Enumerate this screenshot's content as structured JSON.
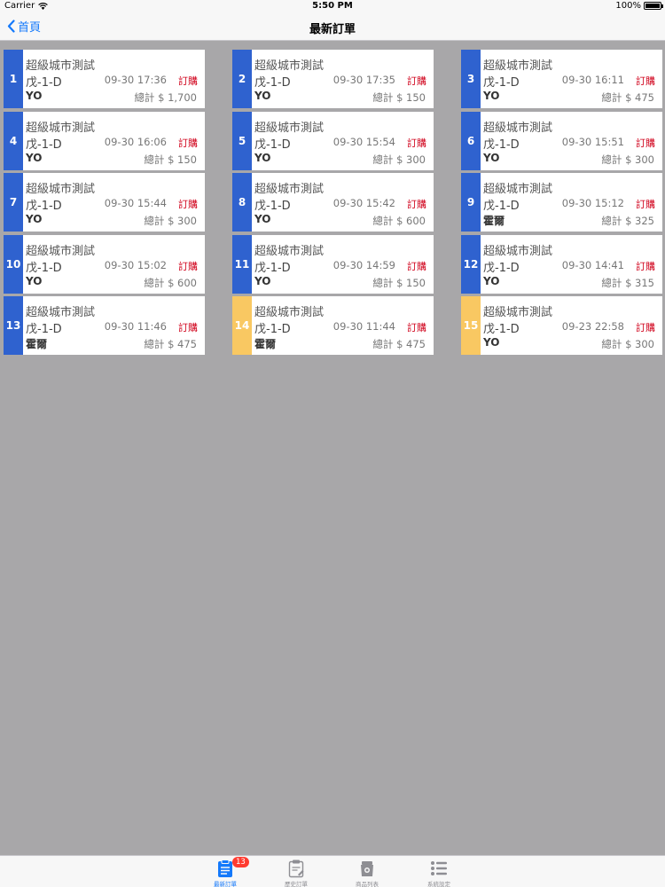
{
  "status_bar": {
    "carrier": "Carrier",
    "time": "5:50 PM",
    "battery": "100%"
  },
  "nav": {
    "back_label": "首頁",
    "title": "最新訂單"
  },
  "colors": {
    "blue_tag": "#2f62cf",
    "yellow_tag": "#f9c862",
    "accent": "#1479fb",
    "order_status": "#d0021b"
  },
  "orders": [
    {
      "num": "1",
      "color": "blue",
      "store": "超級城市測試",
      "table": "戊-1-D",
      "time": "09-30 17:36",
      "status": "訂購",
      "customer": "YO",
      "total": "總計 $  1,700"
    },
    {
      "num": "2",
      "color": "blue",
      "store": "超級城市測試",
      "table": "戊-1-D",
      "time": "09-30 17:35",
      "status": "訂購",
      "customer": "YO",
      "total": "總計 $  150"
    },
    {
      "num": "3",
      "color": "blue",
      "store": "超級城市測試",
      "table": "戊-1-D",
      "time": "09-30 16:11",
      "status": "訂購",
      "customer": "YO",
      "total": "總計 $  475"
    },
    {
      "num": "4",
      "color": "blue",
      "store": "超級城市測試",
      "table": "戊-1-D",
      "time": "09-30 16:06",
      "status": "訂購",
      "customer": "YO",
      "total": "總計 $  150"
    },
    {
      "num": "5",
      "color": "blue",
      "store": "超級城市測試",
      "table": "戊-1-D",
      "time": "09-30 15:54",
      "status": "訂購",
      "customer": "YO",
      "total": "總計 $  300"
    },
    {
      "num": "6",
      "color": "blue",
      "store": "超級城市測試",
      "table": "戊-1-D",
      "time": "09-30 15:51",
      "status": "訂購",
      "customer": "YO",
      "total": "總計 $  300"
    },
    {
      "num": "7",
      "color": "blue",
      "store": "超級城市測試",
      "table": "戊-1-D",
      "time": "09-30 15:44",
      "status": "訂購",
      "customer": "YO",
      "total": "總計 $  300"
    },
    {
      "num": "8",
      "color": "blue",
      "store": "超級城市測試",
      "table": "戊-1-D",
      "time": "09-30 15:42",
      "status": "訂購",
      "customer": "YO",
      "total": "總計 $  600"
    },
    {
      "num": "9",
      "color": "blue",
      "store": "超級城市測試",
      "table": "戊-1-D",
      "time": "09-30 15:12",
      "status": "訂購",
      "customer": "霍爾",
      "total": "總計 $  325"
    },
    {
      "num": "10",
      "color": "blue",
      "store": "超級城市測試",
      "table": "戊-1-D",
      "time": "09-30 15:02",
      "status": "訂購",
      "customer": "YO",
      "total": "總計 $  600"
    },
    {
      "num": "11",
      "color": "blue",
      "store": "超級城市測試",
      "table": "戊-1-D",
      "time": "09-30 14:59",
      "status": "訂購",
      "customer": "YO",
      "total": "總計 $  150"
    },
    {
      "num": "12",
      "color": "blue",
      "store": "超級城市測試",
      "table": "戊-1-D",
      "time": "09-30 14:41",
      "status": "訂購",
      "customer": "YO",
      "total": "總計 $  315"
    },
    {
      "num": "13",
      "color": "blue",
      "store": "超級城市測試",
      "table": "戊-1-D",
      "time": "09-30 11:46",
      "status": "訂購",
      "customer": "霍爾",
      "total": "總計 $  475"
    },
    {
      "num": "14",
      "color": "yellow",
      "store": "超級城市測試",
      "table": "戊-1-D",
      "time": "09-30 11:44",
      "status": "訂購",
      "customer": "霍爾",
      "total": "總計 $  475"
    },
    {
      "num": "15",
      "color": "yellow",
      "store": "超級城市測試",
      "table": "戊-1-D",
      "time": "09-23 22:58",
      "status": "訂購",
      "customer": "YO",
      "total": "總計 $  300"
    }
  ],
  "tabs": [
    {
      "label": "最新訂單",
      "icon": "clipboard-list-icon",
      "badge": "13",
      "active": true
    },
    {
      "label": "歷史訂單",
      "icon": "clipboard-edit-icon",
      "active": false
    },
    {
      "label": "商品列表",
      "icon": "grocery-bag-icon",
      "active": false
    },
    {
      "label": "系統設定",
      "icon": "list-icon",
      "active": false
    }
  ]
}
